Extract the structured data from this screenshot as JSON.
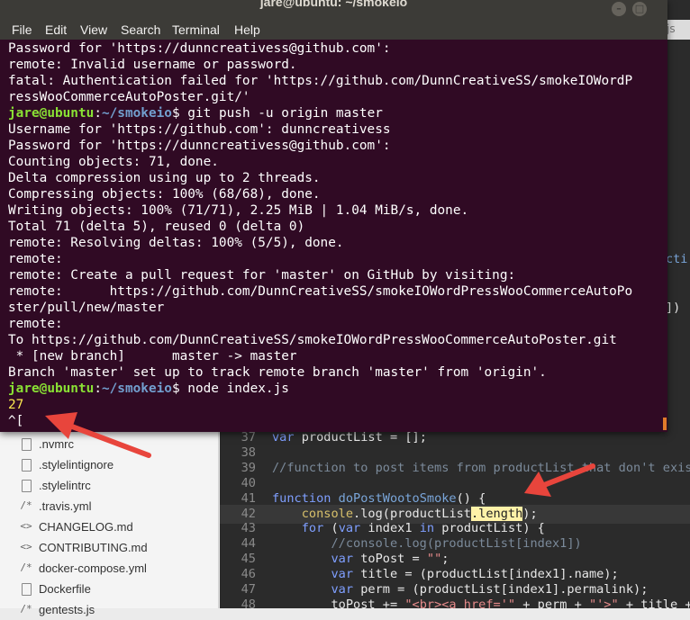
{
  "terminal": {
    "title": "jare@ubuntu: ~/smokeio",
    "menu": [
      "File",
      "Edit",
      "View",
      "Search",
      "Terminal",
      "Help"
    ],
    "lines": [
      {
        "text": "Password for 'https://dunncreativess@github.com':"
      },
      {
        "text": "remote: Invalid username or password."
      },
      {
        "text": "fatal: Authentication failed for 'https://github.com/DunnCreativeSS/smokeIOWordP"
      },
      {
        "text": "ressWooCommerceAutoPoster.git/'"
      },
      {
        "user": "jare@ubuntu",
        "sep": ":",
        "path": "~/smokeio",
        "cmd": "$ git push -u origin master"
      },
      {
        "text": "Username for 'https://github.com': dunncreativess"
      },
      {
        "text": "Password for 'https://dunncreativess@github.com':"
      },
      {
        "text": "Counting objects: 71, done."
      },
      {
        "text": "Delta compression using up to 2 threads."
      },
      {
        "text": "Compressing objects: 100% (68/68), done."
      },
      {
        "text": "Writing objects: 100% (71/71), 2.25 MiB | 1.04 MiB/s, done."
      },
      {
        "text": "Total 71 (delta 5), reused 0 (delta 0)"
      },
      {
        "text": "remote: Resolving deltas: 100% (5/5), done."
      },
      {
        "text": "remote:"
      },
      {
        "text": "remote: Create a pull request for 'master' on GitHub by visiting:"
      },
      {
        "text": "remote:      https://github.com/DunnCreativeSS/smokeIOWordPressWooCommerceAutoPo"
      },
      {
        "text": "ster/pull/new/master"
      },
      {
        "text": "remote:"
      },
      {
        "text": "To https://github.com/DunnCreativeSS/smokeIOWordPressWooCommerceAutoPoster.git"
      },
      {
        "text": " * [new branch]      master -> master"
      },
      {
        "text": "Branch 'master' set up to track remote branch 'master' from 'origin'."
      },
      {
        "user": "jare@ubuntu",
        "sep": ":",
        "path": "~/smokeio",
        "cmd": "$ node index.js"
      },
      {
        "text": "27",
        "style": "yellow"
      },
      {
        "text": "^["
      }
    ]
  },
  "editor": {
    "tab_fragment": "js",
    "right_fragments": [
      {
        "text": "cti",
        "color": "#7aa6da",
        "line": 13
      },
      {
        "text": "])",
        "color": "#e8e8e8",
        "line": 16
      }
    ],
    "files": [
      {
        "icon": "doc",
        "name": ".nvmrc"
      },
      {
        "icon": "doc",
        "name": ".stylelintignore"
      },
      {
        "icon": "doc",
        "name": ".stylelintrc"
      },
      {
        "icon": "/*",
        "name": ".travis.yml"
      },
      {
        "icon": "<>",
        "name": "CHANGELOG.md"
      },
      {
        "icon": "<>",
        "name": "CONTRIBUTING.md"
      },
      {
        "icon": "/*",
        "name": "docker-compose.yml"
      },
      {
        "icon": "doc",
        "name": "Dockerfile"
      },
      {
        "icon": "/*",
        "name": "gentests.js"
      }
    ],
    "code": [
      {
        "n": "37",
        "text": "var productList = [];"
      },
      {
        "n": "38",
        "text": ""
      },
      {
        "n": "39",
        "text": "//function to post items from productList that don't exist"
      },
      {
        "n": "40",
        "text": ""
      },
      {
        "n": "41",
        "text": "function doPostWootoSmoke() {"
      },
      {
        "n": "42",
        "text": "    console.log(productList.length);"
      },
      {
        "n": "43",
        "text": "    for (var index1 in productList) {"
      },
      {
        "n": "44",
        "text": "        //console.log(productList[index1])"
      },
      {
        "n": "45",
        "text": "        var toPost = \"\";"
      },
      {
        "n": "46",
        "text": "        var title = (productList[index1].name);"
      },
      {
        "n": "47",
        "text": "        var perm = (productList[index1].permalink);"
      },
      {
        "n": "48",
        "text": "        toPost += \"<br><a href='\" + perm + \"'>\" + title +"
      }
    ]
  },
  "colors": {
    "terminal_bg": "#300a24",
    "prompt_user": "#8ae234",
    "prompt_path": "#729fcf",
    "arrow": "#e8453c"
  }
}
